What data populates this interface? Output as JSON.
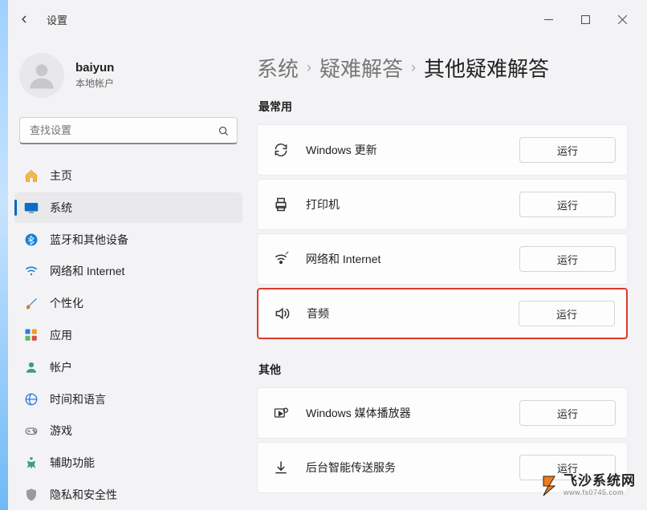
{
  "app": {
    "title": "设置"
  },
  "user": {
    "name": "baiyun",
    "type": "本地帐户"
  },
  "search": {
    "placeholder": "查找设置"
  },
  "breadcrumb": {
    "system": "系统",
    "trouble": "疑难解答",
    "other": "其他疑难解答"
  },
  "sidebar": {
    "items": [
      {
        "label": "主页"
      },
      {
        "label": "系统"
      },
      {
        "label": "蓝牙和其他设备"
      },
      {
        "label": "网络和 Internet"
      },
      {
        "label": "个性化"
      },
      {
        "label": "应用"
      },
      {
        "label": "帐户"
      },
      {
        "label": "时间和语言"
      },
      {
        "label": "游戏"
      },
      {
        "label": "辅助功能"
      },
      {
        "label": "隐私和安全性"
      }
    ]
  },
  "sections": {
    "frequent": "最常用",
    "other": "其他"
  },
  "cards": {
    "windows_update": {
      "label": "Windows 更新",
      "action": "运行"
    },
    "printer": {
      "label": "打印机",
      "action": "运行"
    },
    "network": {
      "label": "网络和 Internet",
      "action": "运行"
    },
    "audio": {
      "label": "音频",
      "action": "运行"
    },
    "media_player": {
      "label": "Windows 媒体播放器",
      "action": "运行"
    },
    "background": {
      "label": "后台智能传送服务",
      "action": "运行"
    }
  },
  "watermark": {
    "big": "飞沙系统网",
    "small": "www.fs0745.com"
  }
}
